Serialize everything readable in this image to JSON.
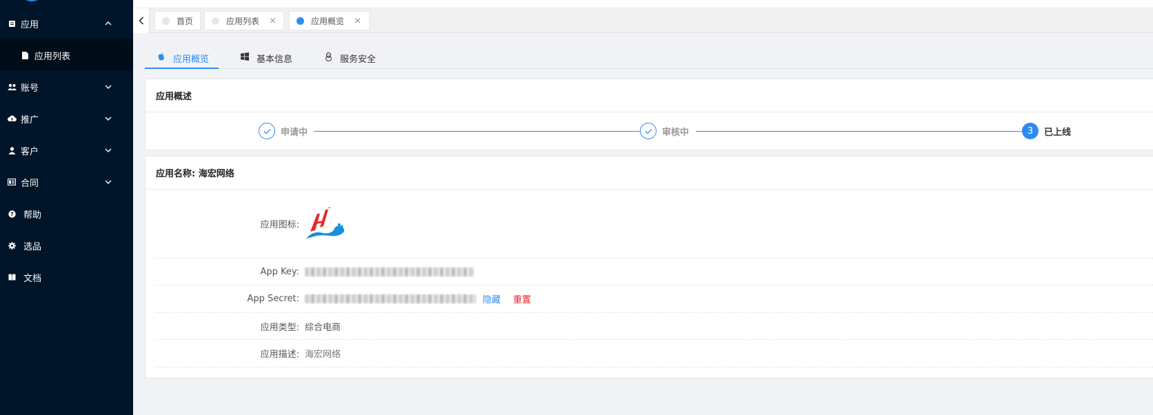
{
  "sidebar": {
    "items": [
      {
        "label": "应用",
        "icon": "app-icon",
        "expanded": true
      },
      {
        "label": "账号",
        "icon": "users-icon"
      },
      {
        "label": "推广",
        "icon": "cloud-upload-icon"
      },
      {
        "label": "客户",
        "icon": "user-icon"
      },
      {
        "label": "合同",
        "icon": "contract-icon"
      },
      {
        "label": "帮助",
        "icon": "help-icon"
      },
      {
        "label": "选品",
        "icon": "gear-icon"
      },
      {
        "label": "文档",
        "icon": "book-icon"
      }
    ],
    "submenu": [
      {
        "label": "应用列表",
        "icon": "file-icon"
      }
    ]
  },
  "page_tabs": [
    {
      "label": "首页",
      "closable": false,
      "active": false
    },
    {
      "label": "应用列表",
      "closable": true,
      "active": false
    },
    {
      "label": "应用概览",
      "closable": true,
      "active": true
    }
  ],
  "close_glyph": "×",
  "sub_tabs": [
    {
      "label": "应用概览",
      "icon": "apple-icon",
      "active": true
    },
    {
      "label": "基本信息",
      "icon": "windows-icon"
    },
    {
      "label": "服务安全",
      "icon": "linux-icon"
    }
  ],
  "overview": {
    "title": "应用概述",
    "steps": [
      {
        "label": "申请中",
        "status": "finished"
      },
      {
        "label": "审核中",
        "status": "finished"
      },
      {
        "label": "已上线",
        "status": "current",
        "number": "3"
      }
    ]
  },
  "details": {
    "title": "应用名称: 海宏网络",
    "rows": {
      "icon_label": "应用图标:",
      "key_label": "App Key:",
      "secret_label": "App Secret:",
      "hide_label": "隐藏",
      "reset_label": "重置",
      "type_label": "应用类型:",
      "type_value": "综合电商",
      "desc_label": "应用描述:",
      "desc_value": "海宏网络"
    }
  },
  "colors": {
    "sidebar_bg": "#001529",
    "accent": "#2d8cf0",
    "danger": "#ed1c24",
    "logo_red": "#e8262e",
    "logo_blue": "#1a8fd8"
  }
}
